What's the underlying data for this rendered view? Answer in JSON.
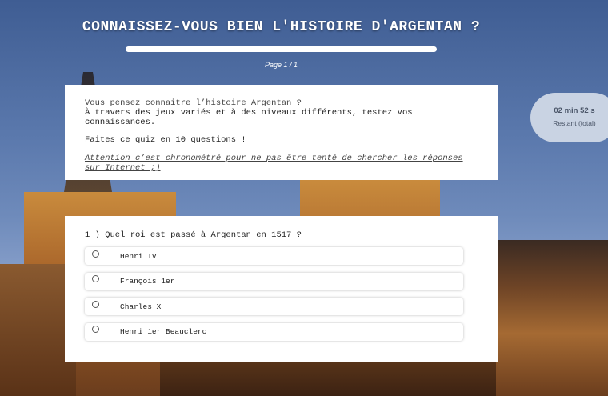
{
  "header": {
    "title": "CONNAISSEZ-VOUS BIEN L'HISTOIRE D'ARGENTAN ?",
    "page_label": "Page 1 / 1",
    "progress_fraction": 0
  },
  "intro": {
    "line1": "Vous pensez connaitre l’histoire Argentan ?",
    "line2": "À travers des jeux variés et à des niveaux différents, testez vos connaissances.",
    "line3": "Faites ce quiz en 10 questions !",
    "warning": "Attention c’est chronométré pour ne pas être tenté de chercher les réponses sur Internet ;)"
  },
  "question": {
    "text": "1 ) Quel roi est passé à Argentan en 1517 ?",
    "options": [
      "Henri IV",
      "François 1er",
      "Charles X",
      "Henri 1er Beauclerc"
    ]
  },
  "timer": {
    "value": "02 min  52 s",
    "label": "Restant (total)"
  }
}
